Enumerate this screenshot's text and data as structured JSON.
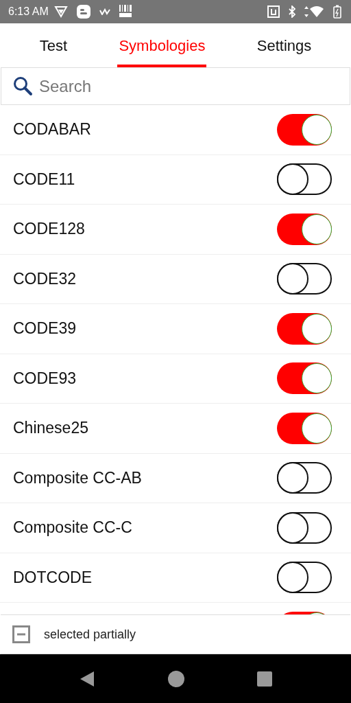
{
  "status_bar": {
    "time": "6:13 AM"
  },
  "tabs": [
    {
      "label": "Test",
      "selected": false
    },
    {
      "label": "Symbologies",
      "selected": true
    },
    {
      "label": "Settings",
      "selected": false
    }
  ],
  "search": {
    "placeholder": "Search"
  },
  "symbologies": [
    {
      "name": "CODABAR",
      "on": true
    },
    {
      "name": "CODE11",
      "on": false
    },
    {
      "name": "CODE128",
      "on": true
    },
    {
      "name": "CODE32",
      "on": false
    },
    {
      "name": "CODE39",
      "on": true
    },
    {
      "name": "CODE93",
      "on": true
    },
    {
      "name": "Chinese25",
      "on": true
    },
    {
      "name": "Composite CC-AB",
      "on": false
    },
    {
      "name": "Composite CC-C",
      "on": false
    },
    {
      "name": "DOTCODE",
      "on": false
    },
    {
      "on": true
    }
  ],
  "select_all": {
    "label": "selected partially",
    "checked": false,
    "partial": true
  }
}
